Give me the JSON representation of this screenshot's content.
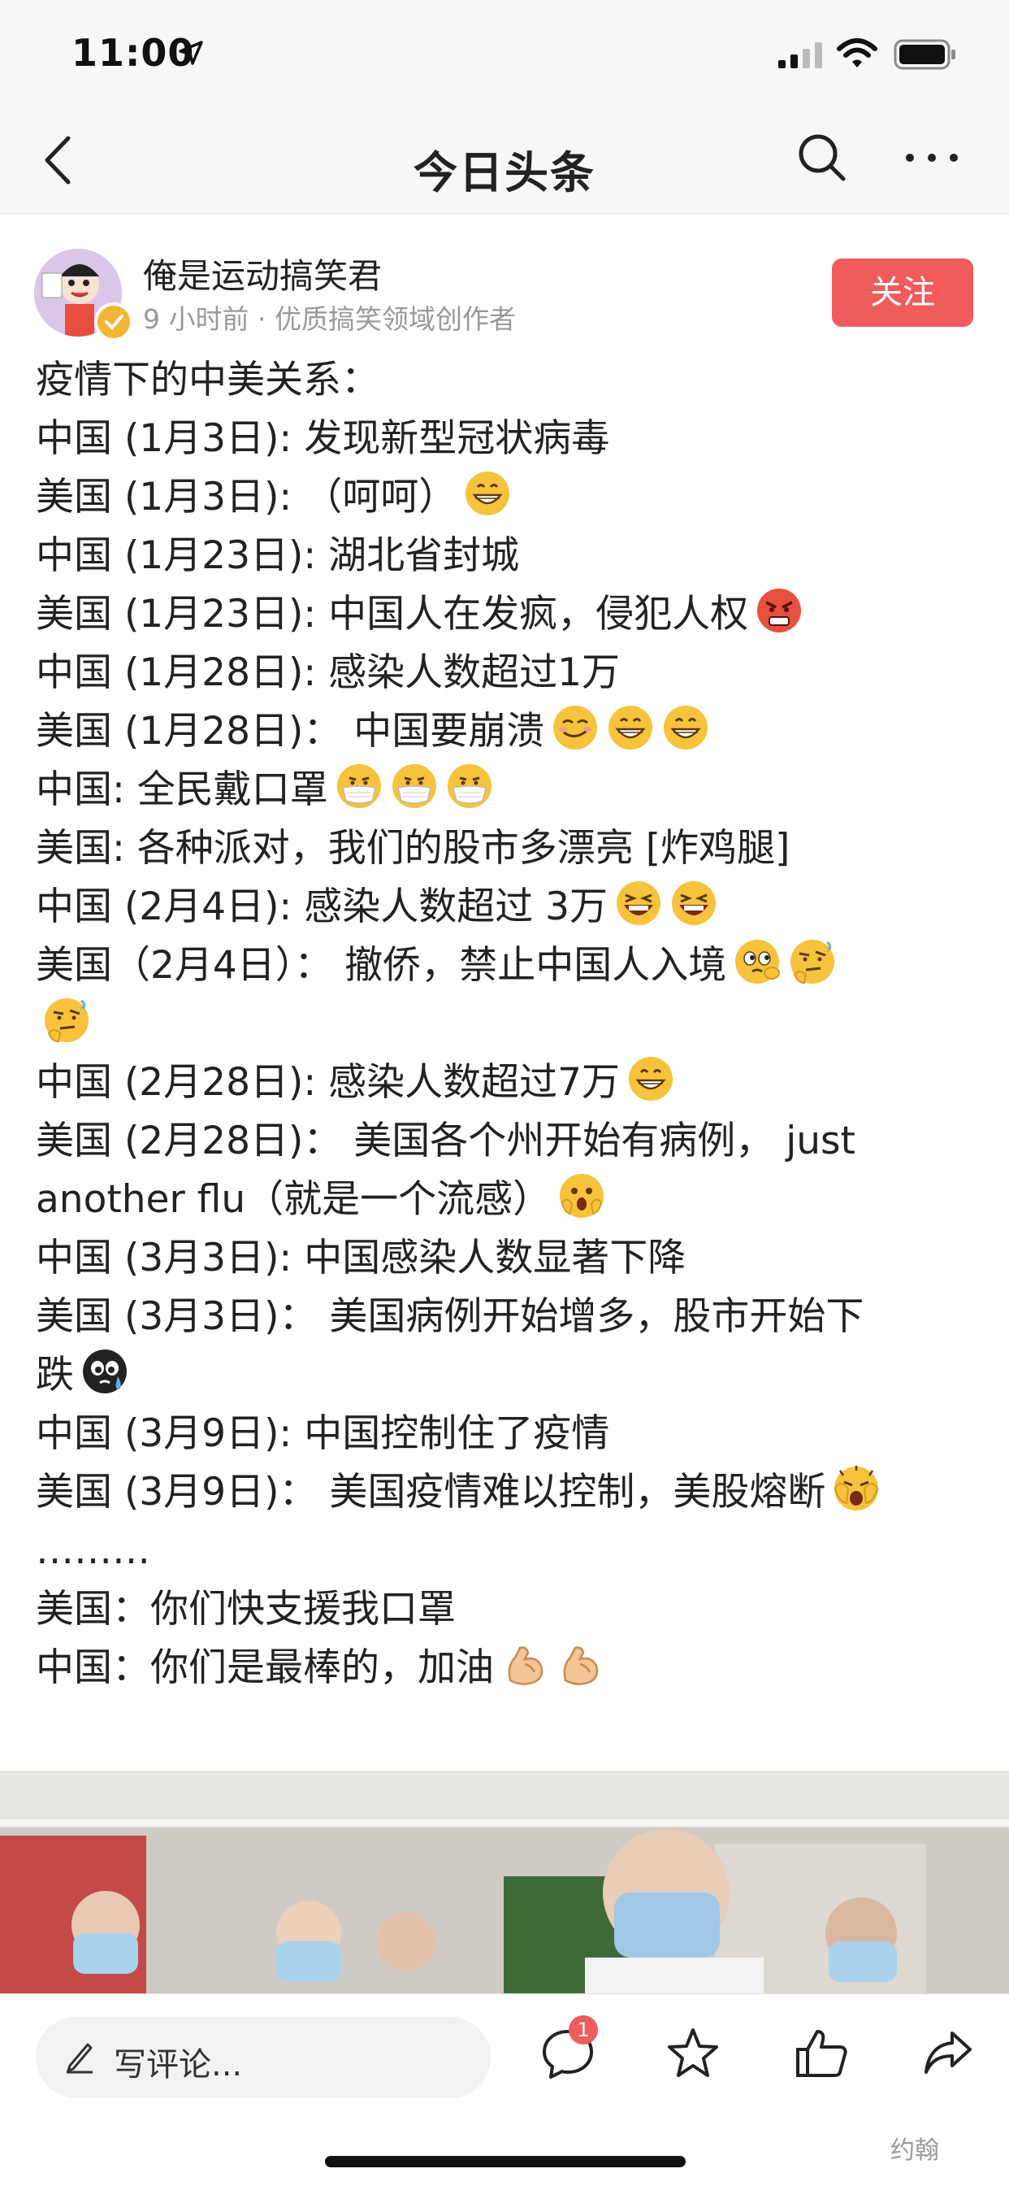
{
  "status_bar": {
    "time": "11:00"
  },
  "nav": {
    "title": "今日头条"
  },
  "author": {
    "name": "俺是运动搞笑君",
    "meta": "9 小时前 · 优质搞笑领域创作者",
    "follow_label": "关注"
  },
  "article": {
    "lines": [
      {
        "text": "疫情下的中美关系：",
        "emojis": []
      },
      {
        "text": "中国 (1月3日): 发现新型冠状病毒",
        "emojis": []
      },
      {
        "text": "美国 (1月3日): （呵呵）",
        "emojis": [
          "grin"
        ]
      },
      {
        "text": "中国 (1月23日): 湖北省封城",
        "emojis": []
      },
      {
        "text": "美国 (1月23日): 中国人在发疯，侵犯人权",
        "emojis": [
          "angry"
        ]
      },
      {
        "text": "中国 (1月28日): 感染人数超过1万",
        "emojis": []
      },
      {
        "text": "美国 (1月28日)： 中国要崩溃",
        "emojis": [
          "smirk",
          "grin",
          "grin"
        ]
      },
      {
        "text": "中国: 全民戴口罩",
        "emojis": [
          "mask",
          "mask",
          "mask"
        ]
      },
      {
        "text": "美国: 各种派对，我们的股市多漂亮 [炸鸡腿]",
        "emojis": []
      },
      {
        "text": "中国 (2月4日): 感染人数超过 3万",
        "emojis": [
          "laugh",
          "laugh"
        ]
      },
      {
        "text": "美国（2月4日）： 撤侨，禁止中国人入境",
        "emojis": [
          "eyes",
          "think"
        ]
      },
      {
        "text": "",
        "emojis": [
          "think"
        ]
      },
      {
        "text": "中国 (2月28日): 感染人数超过7万",
        "emojis": [
          "grin"
        ]
      },
      {
        "text": "美国 (2月28日)： 美国各个州开始有病例， just",
        "emojis": []
      },
      {
        "text": "another flu（就是一个流感）",
        "emojis": [
          "shock"
        ]
      },
      {
        "text": "中国 (3月3日): 中国感染人数显著下降",
        "emojis": []
      },
      {
        "text": "美国 (3月3日)： 美国病例开始增多，股市开始下",
        "emojis": []
      },
      {
        "text": "跌",
        "emojis": [
          "sweat"
        ]
      },
      {
        "text": "中国 (3月9日): 中国控制住了疫情",
        "emojis": []
      },
      {
        "text": "美国 (3月9日)： 美国疫情难以控制，美股熔断",
        "emojis": [
          "shock2"
        ]
      },
      {
        "text": "………",
        "emojis": []
      },
      {
        "text": "美国：你们快支援我口罩",
        "emojis": []
      },
      {
        "text": "中国：你们是最棒的，加油",
        "emojis": [
          "muscle",
          "muscle"
        ]
      }
    ]
  },
  "bottom_bar": {
    "comment_placeholder": "写评论...",
    "comment_count": "1"
  },
  "watermark": "约翰",
  "colors": {
    "accent": "#f05b5c",
    "emoji_yellow": "#f7c23c"
  }
}
